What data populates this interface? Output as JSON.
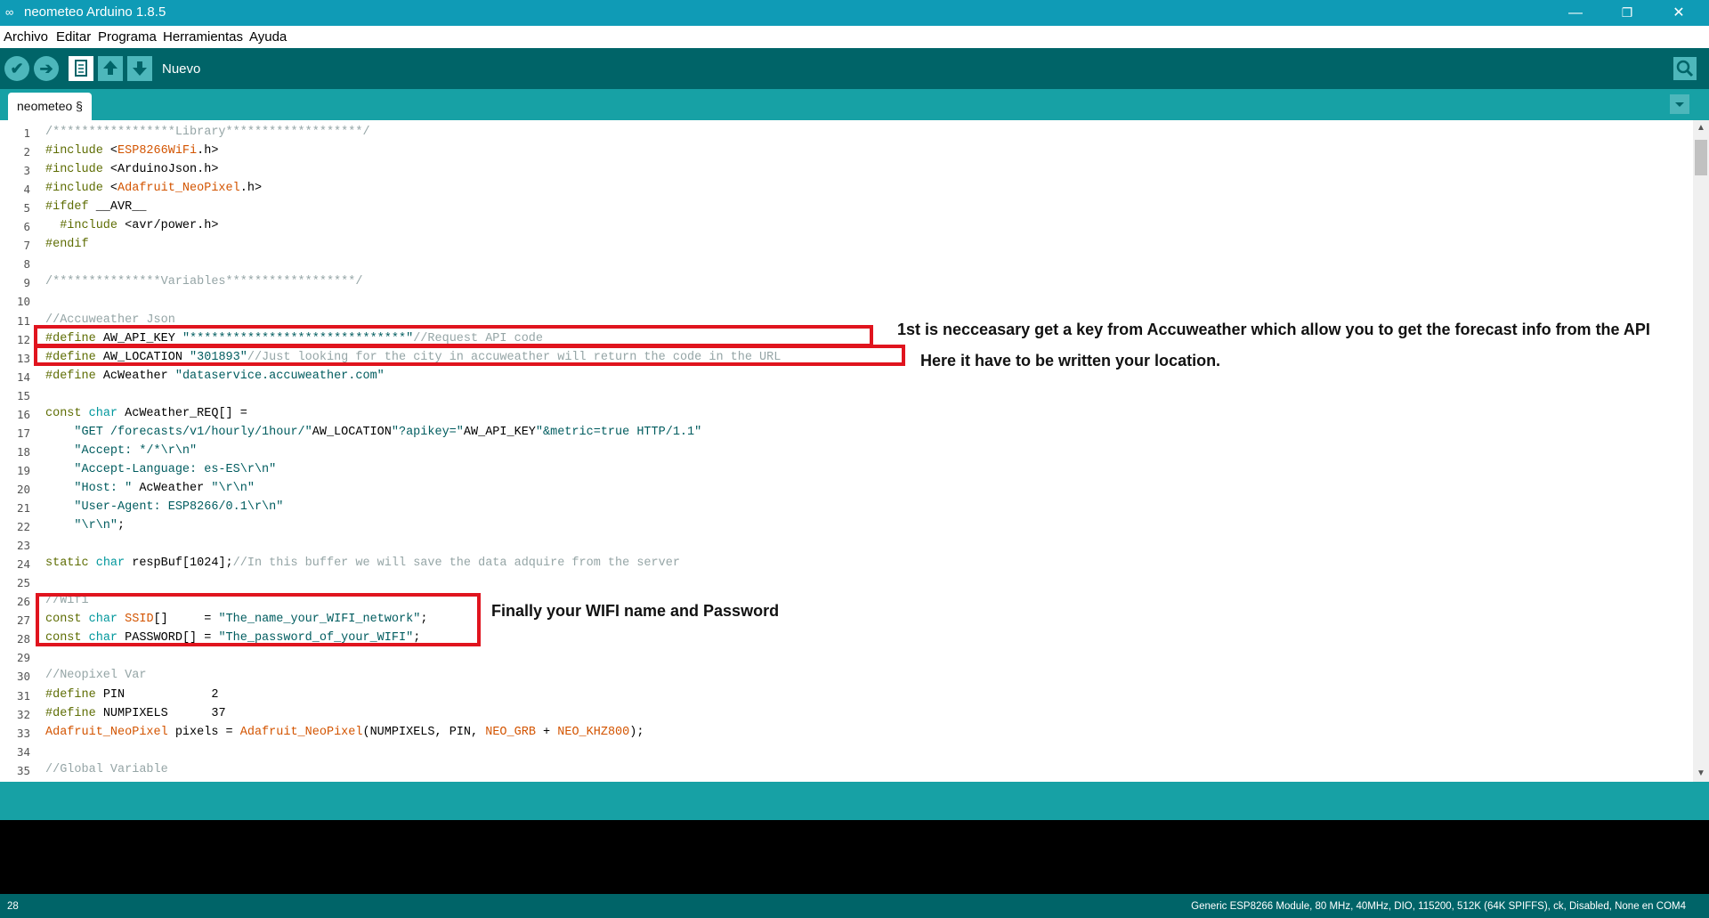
{
  "window": {
    "title": "neometeo Arduino 1.8.5",
    "minimize": "—",
    "maximize": "❐",
    "close": "✕"
  },
  "menu": [
    "Archivo",
    "Editar",
    "Programa",
    "Herramientas",
    "Ayuda"
  ],
  "toolbar": {
    "verify_icon": "✔",
    "upload_icon": "➔",
    "hover_label": "Nuevo"
  },
  "tab": {
    "label": "neometeo §"
  },
  "code": {
    "lines": [
      "/*****************Library*******************/",
      "#include <ESP8266WiFi.h>",
      "#include <ArduinoJson.h>",
      "#include <Adafruit_NeoPixel.h>",
      "#ifdef __AVR__",
      "  #include <avr/power.h>",
      "#endif",
      "",
      "/***************Variables******************/",
      "",
      "//Accuweather Json",
      "#define AW_API_KEY \"******************************\"//Request API code",
      "#define AW_LOCATION \"301893\"//Just looking for the city in accuweather will return the code in the URL",
      "#define AcWeather \"dataservice.accuweather.com\"",
      "",
      "const char AcWeather_REQ[] =",
      "    \"GET /forecasts/v1/hourly/1hour/\"AW_LOCATION\"?apikey=\"AW_API_KEY\"&metric=true HTTP/1.1\"",
      "    \"Accept: */*\\r\\n\"",
      "    \"Accept-Language: es-ES\\r\\n\"",
      "    \"Host: \" AcWeather \"\\r\\n\"",
      "    \"User-Agent: ESP8266/0.1\\r\\n\"",
      "    \"\\r\\n\";",
      "",
      "static char respBuf[1024];//In this buffer we will save the data adquire from the server",
      "",
      "//Wifi",
      "const char SSID[]     = \"The_name_your_WIFI_network\";",
      "const char PASSWORD[] = \"The_password_of_your_WIFI\";",
      "",
      "//Neopixel Var",
      "#define PIN            2",
      "#define NUMPIXELS      37",
      "Adafruit_NeoPixel pixels = Adafruit_NeoPixel(NUMPIXELS, PIN, NEO_GRB + NEO_KHZ800);",
      "",
      "//Global Variable"
    ]
  },
  "annotations": {
    "api_key": "1st is necceasary get a key from Accuweather which allow you to get the forecast info from the API",
    "location": "Here it have to be written your location.",
    "wifi": "Finally your WIFI name and Password"
  },
  "footer": {
    "line_number": "28",
    "board": "Generic ESP8266 Module, 80 MHz, 40MHz, DIO, 115200, 512K (64K SPIFFS), ck, Disabled, None en COM4"
  },
  "colors": {
    "title_bar": "#0f9bb6",
    "toolbar": "#006468",
    "tab_bar": "#17a1a5",
    "annotation_box": "#e0141e"
  }
}
